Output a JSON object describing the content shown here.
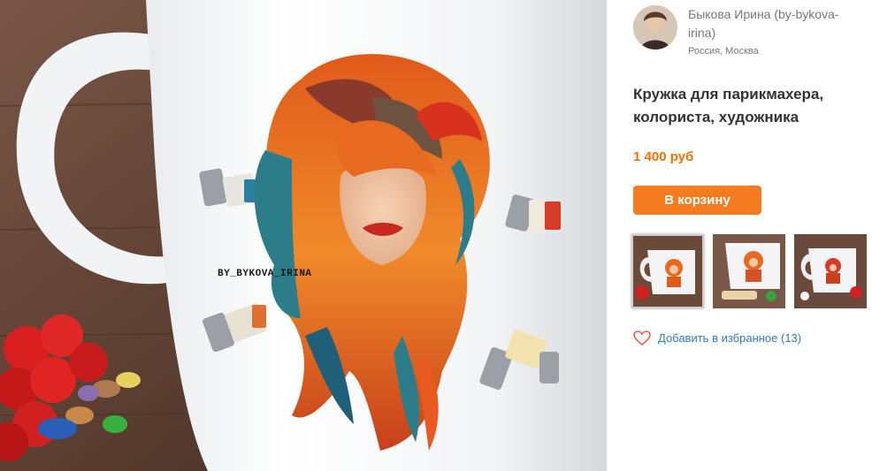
{
  "seller": {
    "name": "Быкова Ирина (by-bykova-irina)",
    "city": "Россия, Москва"
  },
  "product": {
    "title": "Кружка для парикмахера, колориста, художника",
    "price": "1 400 руб",
    "watermark": "BY_BYKOVA_IRINA"
  },
  "actions": {
    "cart_label": "В корзину",
    "favorite_label": "Добавить в избранное (13)"
  },
  "colors": {
    "accent": "#f47b20",
    "price": "#f07000",
    "link": "#337ab7"
  }
}
